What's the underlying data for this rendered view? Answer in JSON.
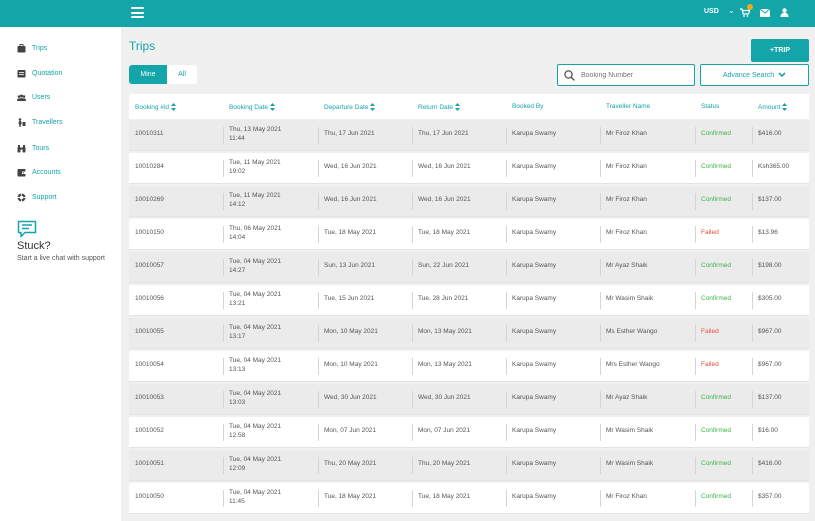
{
  "header": {
    "currency": "USD"
  },
  "sidebar": {
    "items": [
      {
        "label": "Trips",
        "icon": "suitcase-icon"
      },
      {
        "label": "Quotation",
        "icon": "quotation-icon"
      },
      {
        "label": "Users",
        "icon": "users-icon"
      },
      {
        "label": "Travellers",
        "icon": "travellers-icon"
      },
      {
        "label": "Tours",
        "icon": "binoculars-icon"
      },
      {
        "label": "Accounts",
        "icon": "wallet-icon"
      },
      {
        "label": "Support",
        "icon": "support-icon"
      }
    ],
    "stuck_title": "Stuck?",
    "stuck_text": "Start a live chat with support"
  },
  "main": {
    "title": "Trips",
    "add_trip_label": "+TRIP",
    "tabs": [
      "Mine",
      "All"
    ],
    "search_placeholder": "Booking Number",
    "advance_search_label": "Advance Search"
  },
  "table": {
    "columns": [
      "Booking #id",
      "Booking Date",
      "Departure Date",
      "Return Date",
      "Booked By",
      "Traveller Name",
      "Status",
      "Amount"
    ],
    "rows": [
      {
        "id": "10010311",
        "booking_date": "Thu, 13 May 2021",
        "booking_time": "11:44",
        "departure": "Thu, 17 Jun 2021",
        "return": "Thu, 17 Jun 2021",
        "booked_by": "Karupa Swamy",
        "traveller": "Mr Firoz Khan",
        "status": "Confirmed",
        "amount": "$416.00"
      },
      {
        "id": "10010284",
        "booking_date": "Tue, 11 May 2021",
        "booking_time": "19:02",
        "departure": "Wed, 16 Jun 2021",
        "return": "Wed, 16 Jun 2021",
        "booked_by": "Karupa Swamy",
        "traveller": "Mr Firoz Khan",
        "status": "Confirmed",
        "amount": "Ksh365.00"
      },
      {
        "id": "10010269",
        "booking_date": "Tue, 11 May 2021",
        "booking_time": "14:12",
        "departure": "Wed, 16 Jun 2021",
        "return": "Wed, 16 Jun 2021",
        "booked_by": "Karupa Swamy",
        "traveller": "Mr Firoz Khan",
        "status": "Confirmed",
        "amount": "$137.00"
      },
      {
        "id": "10010150",
        "booking_date": "Thu, 06 May 2021",
        "booking_time": "14:04",
        "departure": "Tue, 18 May 2021",
        "return": "Tue, 18 May 2021",
        "booked_by": "Karupa Swamy",
        "traveller": "Mr Firoz Khan",
        "status": "Failed",
        "amount": "$13.96"
      },
      {
        "id": "10010057",
        "booking_date": "Tue, 04 May 2021",
        "booking_time": "14:27",
        "departure": "Sun, 13 Jun 2021",
        "return": "Sun, 22 Jun 2021",
        "booked_by": "Karupa Swamy",
        "traveller": "Mr Ayaz Shaik",
        "status": "Confirmed",
        "amount": "$198.00"
      },
      {
        "id": "10010056",
        "booking_date": "Tue, 04 May 2021",
        "booking_time": "13:21",
        "departure": "Tue, 15 Jun 2021",
        "return": "Tue, 28 Jun 2021",
        "booked_by": "Karupa Swamy",
        "traveller": "Mr Wasim Shaik",
        "status": "Confirmed",
        "amount": "$305.00"
      },
      {
        "id": "10010055",
        "booking_date": "Tue, 04 May 2021",
        "booking_time": "13:17",
        "departure": "Mon, 10 May 2021",
        "return": "Mon, 13 May 2021",
        "booked_by": "Karupa Swamy",
        "traveller": "Ms Esther Wango",
        "status": "Failed",
        "amount": "$967.00"
      },
      {
        "id": "10010054",
        "booking_date": "Tue, 04 May 2021",
        "booking_time": "13:13",
        "departure": "Mon, 10 May 2021",
        "return": "Mon, 13 May 2021",
        "booked_by": "Karupa Swamy",
        "traveller": "Mrs Esther Wango",
        "status": "Failed",
        "amount": "$967.00"
      },
      {
        "id": "10010053",
        "booking_date": "Tue, 04 May 2021",
        "booking_time": "13:03",
        "departure": "Wed, 30 Jun 2021",
        "return": "Wed, 30 Jun 2021",
        "booked_by": "Karupa Swamy",
        "traveller": "Mr Ayaz Shaik",
        "status": "Confirmed",
        "amount": "$137.00"
      },
      {
        "id": "10010052",
        "booking_date": "Tue, 04 May 2021",
        "booking_time": "12:58",
        "departure": "Mon, 07 Jun 2021",
        "return": "Mon, 07 Jun 2021",
        "booked_by": "Karupa Swamy",
        "traveller": "Mr Wasim Shaik",
        "status": "Confirmed",
        "amount": "$16.00"
      },
      {
        "id": "10010051",
        "booking_date": "Tue, 04 May 2021",
        "booking_time": "12:09",
        "departure": "Thu, 20 May 2021",
        "return": "Thu, 20 May 2021",
        "booked_by": "Karupa Swamy",
        "traveller": "Mr Wasim Shaik",
        "status": "Confirmed",
        "amount": "$416.00"
      },
      {
        "id": "10010050",
        "booking_date": "Tue, 04 May 2021",
        "booking_time": "11:45",
        "departure": "Tue, 18 May 2021",
        "return": "Tue, 18 May 2021",
        "booked_by": "Karupa Swamy",
        "traveller": "Mr Firoz Khan",
        "status": "Confirmed",
        "amount": "$357.00"
      }
    ]
  },
  "colors": {
    "accent": "#14a5a8",
    "confirmed": "#3cb34a",
    "failed": "#e74c3c",
    "badge": "#f2a818"
  }
}
